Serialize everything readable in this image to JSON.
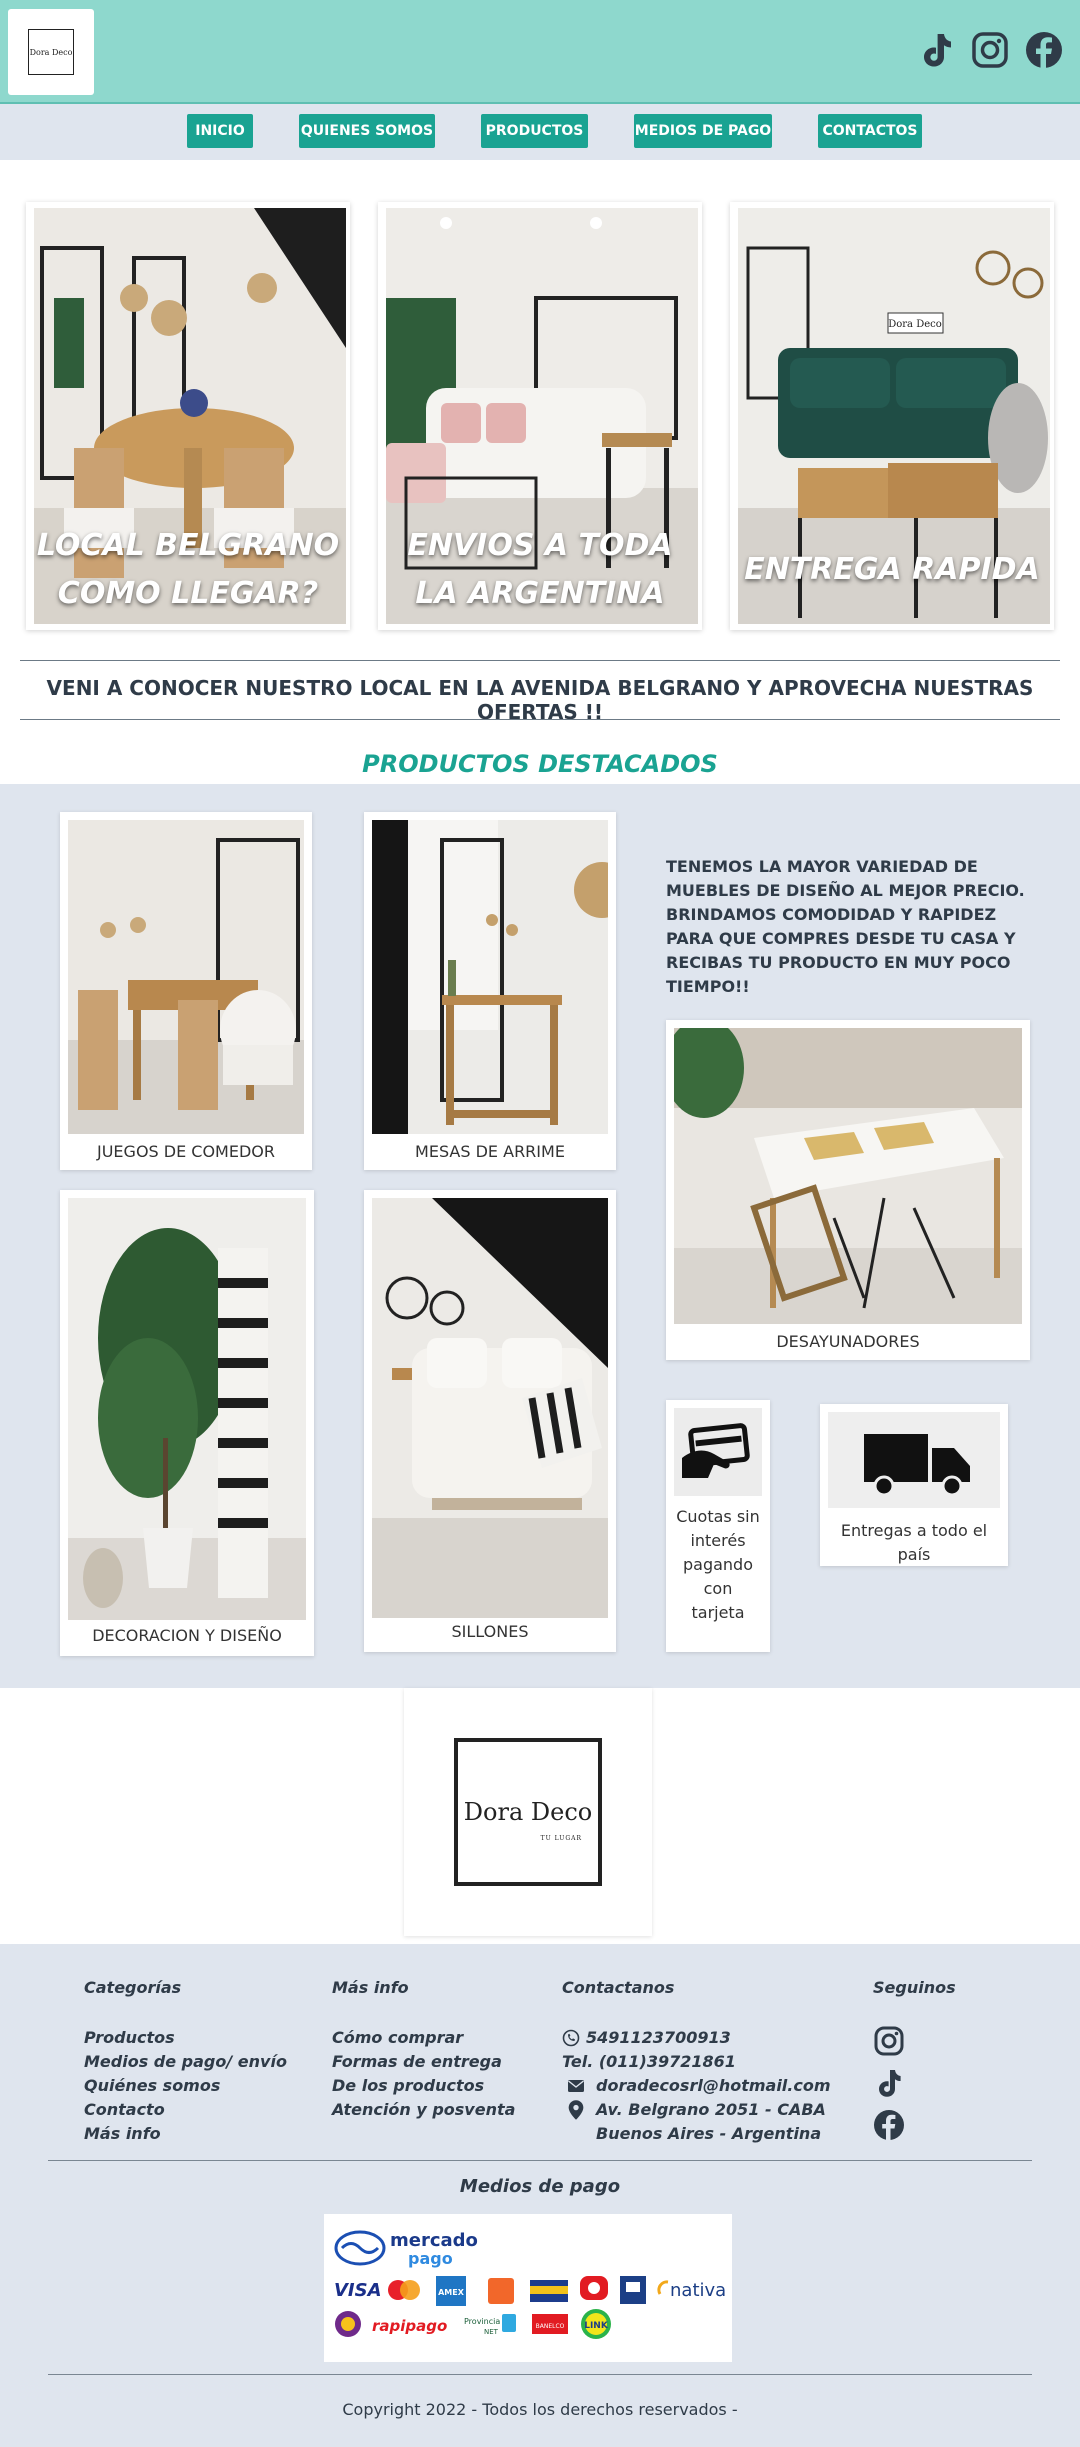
{
  "header": {
    "logo_text": "Dora Deco",
    "social_icons": [
      "tiktok-icon",
      "instagram-icon",
      "facebook-icon"
    ]
  },
  "nav": {
    "items": [
      "INICIO",
      "QUIENES SOMOS",
      "PRODUCTOS",
      "MEDIOS DE PAGO",
      "CONTACTOS"
    ]
  },
  "hero": {
    "cards": [
      {
        "title": "LOCAL BELGRANO COMO LLEGAR?"
      },
      {
        "title": "ENVIOS A TODA LA ARGENTINA"
      },
      {
        "title": "ENTREGA RAPIDA"
      }
    ]
  },
  "promo": "VENI A CONOCER NUESTRO LOCAL EN LA AVENIDA BELGRANO Y APROVECHA NUESTRAS OFERTAS !!",
  "featured": {
    "title": "PRODUCTOS DESTACADOS",
    "description": "TENEMOS LA MAYOR VARIEDAD DE MUEBLES DE DISEÑO AL MEJOR PRECIO. BRINDAMOS COMODIDAD Y RAPIDEZ PARA QUE COMPRES DESDE TU CASA Y RECIBAS TU PRODUCTO EN MUY POCO TIEMPO!!",
    "products": [
      {
        "label": "JUEGOS DE COMEDOR"
      },
      {
        "label": "MESAS DE ARRIME"
      },
      {
        "label": "DECORACION Y DISEÑO"
      },
      {
        "label": "SILLONES"
      },
      {
        "label": "DESAYUNADORES"
      }
    ],
    "benefits": [
      {
        "label": "Cuotas sin interés pagando con tarjeta",
        "icon": "card-hand-icon"
      },
      {
        "label": "Entregas a todo el país",
        "icon": "truck-icon"
      }
    ]
  },
  "logo_section": {
    "logo_text": "Dora Deco",
    "logo_sub": "TU LUGAR"
  },
  "footer": {
    "categories": {
      "heading": "Categorías",
      "links": [
        "Productos",
        "Medios de pago/ envío",
        "Quiénes somos",
        "Contacto",
        "Más info"
      ]
    },
    "more_info": {
      "heading": "Más info",
      "links": [
        "Cómo comprar",
        "Formas de entrega",
        "De los productos",
        "Atención y posventa"
      ]
    },
    "contact": {
      "heading": "Contactanos",
      "whatsapp": "5491123700913",
      "phone": "Tel. (011)39721861",
      "email": "doradecosrl@hotmail.com",
      "address_line1": "Av. Belgrano 2051 - CABA",
      "address_line2": "Buenos Aires - Argentina"
    },
    "follow": {
      "heading": "Seguinos",
      "icons": [
        "instagram-icon",
        "tiktok-icon",
        "facebook-icon"
      ]
    },
    "payment_title": "Medios de pago",
    "payment_methods": {
      "mercadopago": "mercado pago",
      "visa": "VISA",
      "mastercard": "MasterCard",
      "amex": "AMEX",
      "naranja": "naranja",
      "tarjeta_shopping": "SHOPPING",
      "argencard": "Argencard",
      "cabal": "CABAL",
      "nativa": "nativa",
      "diners": "Diners",
      "rapipago": "rapipago",
      "provincia_net": "Provincia NET",
      "cobro_express": "BANELCO",
      "link": "LINK"
    },
    "copyright": "Copyright 2022 - Todos los derechos reservados -"
  },
  "colors": {
    "header_bg": "#8ed8cd",
    "accent": "#1aa392",
    "section_bg": "#dfe5ee",
    "text_dark": "#2f3b48"
  }
}
